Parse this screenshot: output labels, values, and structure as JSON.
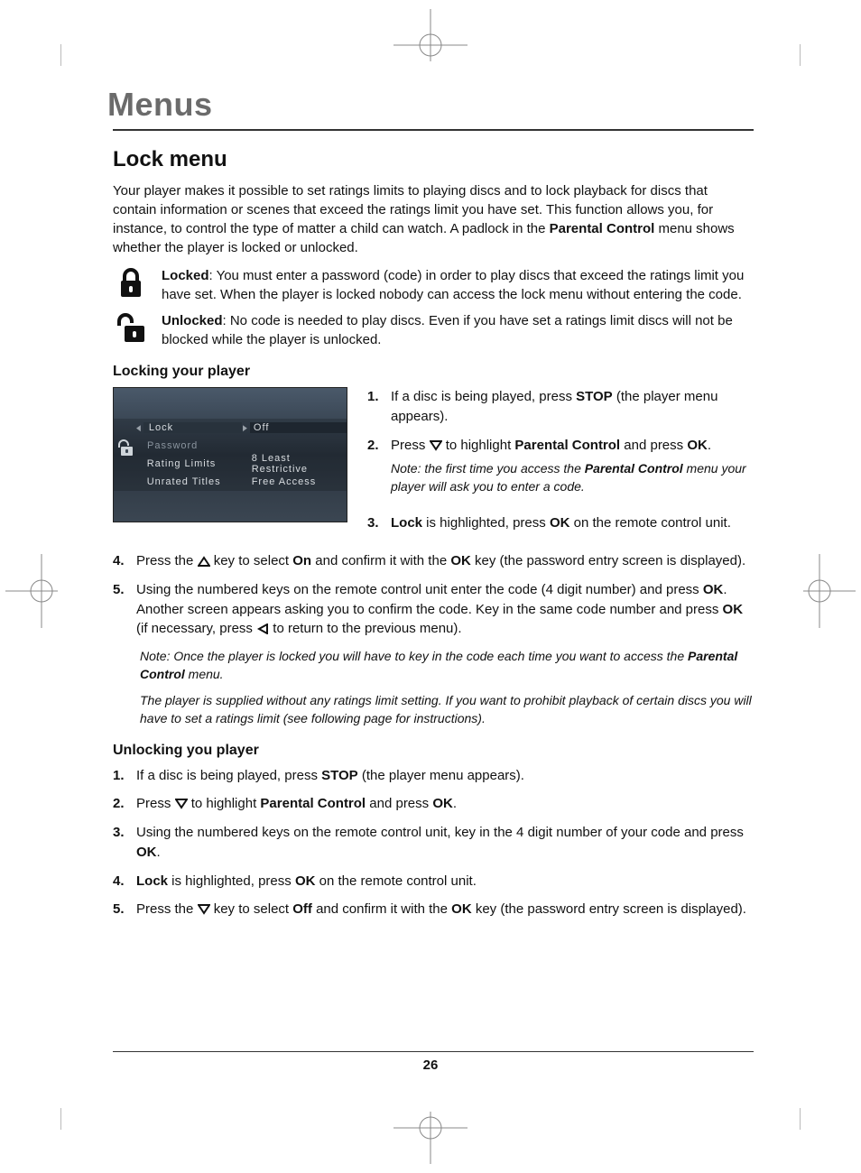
{
  "page": {
    "chapter": "Menus",
    "number": "26"
  },
  "section": {
    "title": "Lock menu",
    "intro_pre": "Your player makes it possible to set ratings limits to playing discs and to lock playback for discs that contain information or scenes that exceed the ratings limit you have set. This function allows you, for instance, to control the type of matter a child can watch. A padlock in the ",
    "intro_bold": "Parental Control",
    "intro_post": " menu shows whether the player is locked or unlocked.",
    "locked_label": "Locked",
    "locked_text": ": You must enter a password (code) in order to play discs that exceed the ratings limit you have set. When the player is locked nobody can access the lock menu without entering the code.",
    "unlocked_label": "Unlocked",
    "unlocked_text": ": No code is needed to play discs. Even if you have set a ratings limit discs will not be blocked while the player is unlocked."
  },
  "screenshot": {
    "rows": [
      {
        "label": "Lock",
        "value": "Off",
        "selected": true
      },
      {
        "label": "Password",
        "value": "",
        "dim": true
      },
      {
        "label": "Rating Limits",
        "value": "8 Least Restrictive"
      },
      {
        "label": "Unrated Titles",
        "value": "Free Access"
      }
    ]
  },
  "locking": {
    "heading": "Locking your player",
    "step1_pre": "If a disc is being played, press ",
    "step1_bold": "STOP",
    "step1_post": " (the player menu appears).",
    "step2_pre": "Press ",
    "step2_mid": " to highlight ",
    "step2_bold": "Parental Control",
    "step2_post": " and press ",
    "step2_ok": "OK",
    "step2_end": ".",
    "step2_note_pre": "Note: the first time you access the ",
    "step2_note_bold": "Parental Control",
    "step2_note_post": " menu your player will ask you to enter a code.",
    "step3_bold": "Lock",
    "step3_mid": " is highlighted, press ",
    "step3_ok": "OK",
    "step3_post": " on the remote control unit.",
    "step4_pre": "Press the ",
    "step4_mid": " key to select ",
    "step4_bold": "On",
    "step4_mid2": " and confirm it with the ",
    "step4_ok": "OK",
    "step4_post": " key (the password entry screen is displayed).",
    "step5_pre": "Using the numbered keys on the remote control unit enter the code (4 digit number) and press ",
    "step5_ok": "OK",
    "step5_mid": ". Another screen appears asking you to confirm the code. Key in the same code number and press ",
    "step5_ok2": "OK",
    "step5_mid2": " (if necessary, press ",
    "step5_post": " to return to the previous menu).",
    "note1_pre": "Note: Once the player is locked you will have to key in the code each time you want to access the ",
    "note1_bold": "Parental Control",
    "note1_post": " menu.",
    "note2": "The player is supplied without any ratings limit setting. If you want to prohibit playback of certain discs you will have to set a ratings limit (see following page for instructions)."
  },
  "unlocking": {
    "heading": "Unlocking you player",
    "step1_pre": "If a disc is being played, press ",
    "step1_bold": "STOP",
    "step1_post": " (the player menu appears).",
    "step2_pre": "Press ",
    "step2_mid": " to highlight ",
    "step2_bold": "Parental Control",
    "step2_post": " and press ",
    "step2_ok": "OK",
    "step2_end": ".",
    "step3_pre": "Using the numbered keys on the remote control unit, key in the 4 digit number of your code and press ",
    "step3_ok": "OK",
    "step3_end": ".",
    "step4_bold": "Lock",
    "step4_mid": " is highlighted, press ",
    "step4_ok": "OK",
    "step4_post": " on the remote control unit.",
    "step5_pre": "Press the ",
    "step5_mid": " key to select ",
    "step5_bold": "Off",
    "step5_mid2": " and confirm it with the ",
    "step5_ok": "OK",
    "step5_post": " key (the password entry screen is displayed)."
  }
}
